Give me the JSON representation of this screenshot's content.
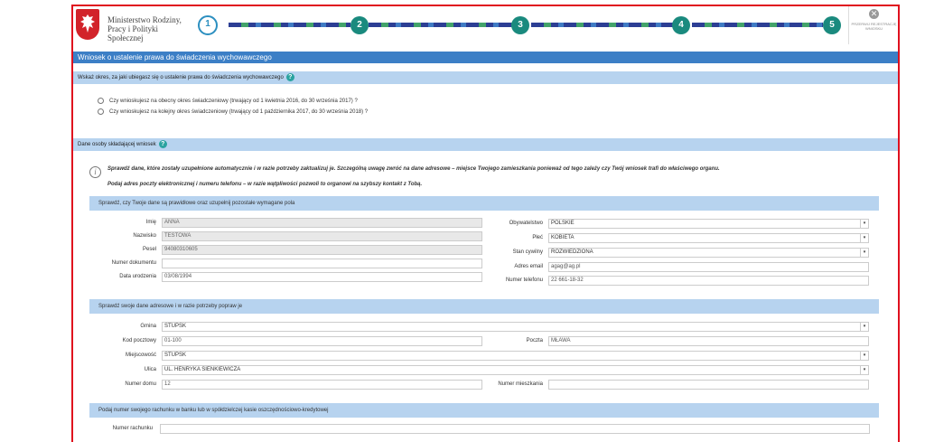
{
  "header": {
    "ministry_line1": "Ministerstwo Rodziny,",
    "ministry_line2": "Pracy i Polityki Społecznej",
    "steps": [
      "1",
      "2",
      "3",
      "4",
      "5"
    ],
    "cancel_label": "PRZERWIJ REJESTRACJĘ WNIOSKU"
  },
  "title": "Wniosek o ustalenie prawa do świadczenia wychowawczego",
  "period_section": {
    "label": "Wskaż okres, za jaki ubiegasz się o ustalenie prawa do świadczenia wychowawczego",
    "options": [
      "Czy wnioskujesz na obecny okres świadczeniowy (trwający od 1 kwietnia 2016, do 30 września 2017) ?",
      "Czy wnioskujesz na kolejny okres świadczeniowy (trwający od 1 października 2017, do 30 września 2018) ?"
    ]
  },
  "applicant_section": {
    "label": "Dane osoby składającej wniosek",
    "info_line1": "Sprawdź dane, które zostały uzupełnione automatycznie i w razie potrzeby zaktualizuj je. Szczególną uwagę zwróć na dane adresowe – miejsce Twojego zamieszkania ponieważ od tego zależy czy Twój wniosek trafi do właściwego organu.",
    "info_line2": "Podaj adres poczty elektronicznej i numeru telefonu – w razie wątpliwości pozwoli to organowi na szybszy kontakt z Tobą."
  },
  "personal": {
    "bar": "Sprawdź, czy Twoje dane są prawidłowe oraz uzupełnij pozostałe wymagane pola",
    "imie_label": "Imię",
    "imie": "ANNA",
    "nazwisko_label": "Nazwisko",
    "nazwisko": "TESTOWA",
    "pesel_label": "Pesel",
    "pesel": "94080310605",
    "dokument_label": "Numer dokumentu",
    "dokument": "",
    "urodzenie_label": "Data urodzenia",
    "urodzenie": "03/08/1994",
    "obywatelstwo_label": "Obywatelstwo",
    "obywatelstwo": "POLSKIE",
    "plec_label": "Płeć",
    "plec": "KOBIETA",
    "stan_label": "Stan cywilny",
    "stan": "ROZWIEDZIONA",
    "email_label": "Adres email",
    "email": "agag@ag.pl",
    "telefon_label": "Numer telefonu",
    "telefon": "22 661-18-32"
  },
  "address": {
    "bar": "Sprawdź swoje dane adresowe i w razie potrzeby popraw je",
    "gmina_label": "Gmina",
    "gmina": "STUPSK",
    "kod_label": "Kod pocztowy",
    "kod": "01-100",
    "poczta_label": "Poczta",
    "poczta": "MŁAWA",
    "miejscowosc_label": "Miejscowość",
    "miejscowosc": "STUPSK",
    "ulica_label": "Ulica",
    "ulica": "UL. HENRYKA SIENKIEWICZA",
    "dom_label": "Numer domu",
    "dom": "12",
    "mieszkanie_label": "Numer mieszkania",
    "mieszkanie": ""
  },
  "bank": {
    "bar": "Podaj numer swojego rachunku w banku lub w spółdzielczej kasie oszczędnościowo-kredytowej",
    "rachunek_label": "Numer rachunku",
    "rachunek": ""
  },
  "colors": {
    "frame": "#e0101e",
    "title_bar": "#3c7fc6",
    "section_bar": "#b7d3ef",
    "step_done": "#1a8a7e",
    "step_active": "#2c8fc0"
  }
}
